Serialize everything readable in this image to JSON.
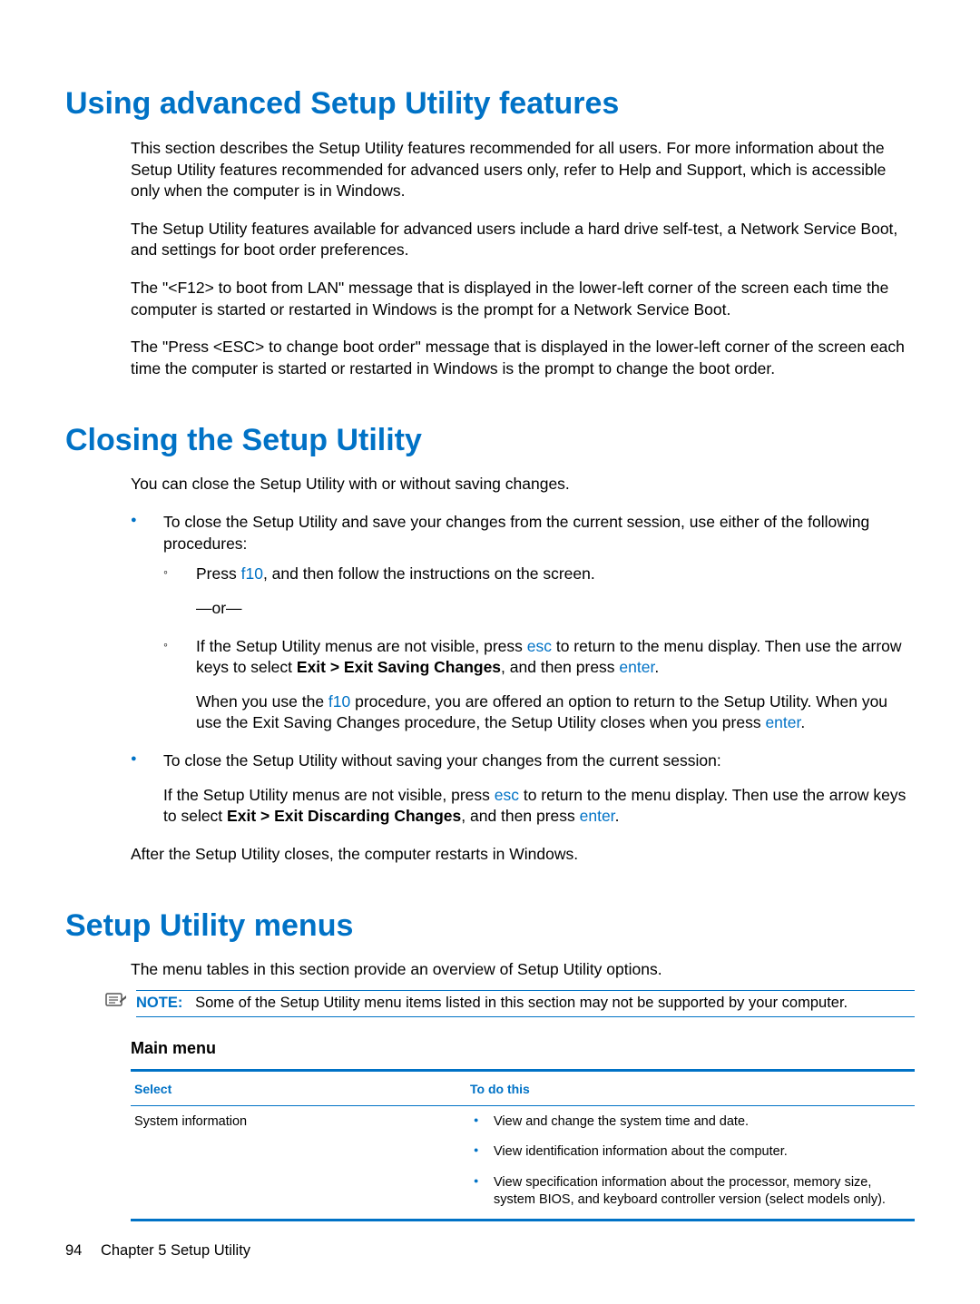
{
  "sections": {
    "s1": {
      "heading": "Using advanced Setup Utility features",
      "p1": "This section describes the Setup Utility features recommended for all users. For more information about the Setup Utility features recommended for advanced users only, refer to Help and Support, which is accessible only when the computer is in Windows.",
      "p2": "The Setup Utility features available for advanced users include a hard drive self-test, a Network Service Boot, and settings for boot order preferences.",
      "p3": "The \"<F12> to boot from LAN\" message that is displayed in the lower-left corner of the screen each time the computer is started or restarted in Windows is the prompt for a Network Service Boot.",
      "p4": "The \"Press <ESC> to change boot order\" message that is displayed in the lower-left corner of the screen each time the computer is started or restarted in Windows is the prompt to change the boot order."
    },
    "s2": {
      "heading": "Closing the Setup Utility",
      "intro": "You can close the Setup Utility with or without saving changes.",
      "li1_intro": "To close the Setup Utility and save your changes from the current session, use either of the following procedures:",
      "li1_a_pre": "Press ",
      "li1_a_key": "f10",
      "li1_a_post": ", and then follow the instructions on the screen.",
      "or": "—or—",
      "li1_b_pre": "If the Setup Utility menus are not visible, press ",
      "li1_b_key": "esc",
      "li1_b_mid": " to return to the menu display. Then use the arrow keys to select ",
      "li1_b_bold": "Exit > Exit Saving Changes",
      "li1_b_post1": ", and then press ",
      "li1_b_enter": "enter",
      "li1_b_post2": ".",
      "li1_b_note_pre": "When you use the ",
      "li1_b_note_key": "f10",
      "li1_b_note_mid": " procedure, you are offered an option to return to the Setup Utility. When you use the Exit Saving Changes procedure, the Setup Utility closes when you press ",
      "li1_b_note_enter": "enter",
      "li1_b_note_post": ".",
      "li2_intro": "To close the Setup Utility without saving your changes from the current session:",
      "li2_body_pre": "If the Setup Utility menus are not visible, press ",
      "li2_body_key": "esc",
      "li2_body_mid": " to return to the menu display. Then use the arrow keys to select ",
      "li2_body_bold": "Exit > Exit Discarding Changes",
      "li2_body_post1": ", and then press ",
      "li2_body_enter": "enter",
      "li2_body_post2": ".",
      "outro": "After the Setup Utility closes, the computer restarts in Windows."
    },
    "s3": {
      "heading": "Setup Utility menus",
      "intro": "The menu tables in this section provide an overview of Setup Utility options.",
      "note_label": "NOTE:",
      "note_text": "Some of the Setup Utility menu items listed in this section may not be supported by your computer.",
      "sub": "Main menu",
      "th_select": "Select",
      "th_todo": "To do this",
      "row1_select": "System information",
      "row1_b1": "View and change the system time and date.",
      "row1_b2": "View identification information about the computer.",
      "row1_b3": "View specification information about the processor, memory size, system BIOS, and keyboard controller version (select models only)."
    }
  },
  "footer": {
    "page": "94",
    "chapter": "Chapter 5   Setup Utility"
  }
}
